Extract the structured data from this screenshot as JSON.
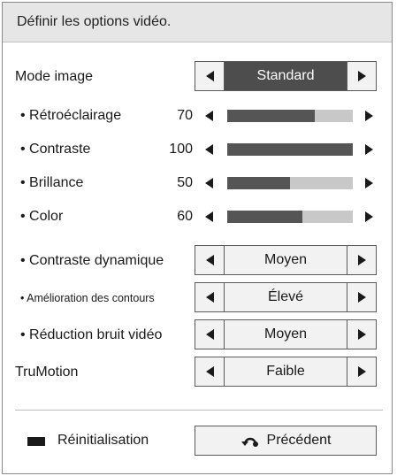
{
  "header": {
    "title": "Définir les options vidéo."
  },
  "mode_image": {
    "label": "Mode image",
    "value": "Standard"
  },
  "sliders": [
    {
      "label": "• Rétroéclairage",
      "value": 70
    },
    {
      "label": "• Contraste",
      "value": 100
    },
    {
      "label": "• Brillance",
      "value": 50
    },
    {
      "label": "• Color",
      "value": 60
    }
  ],
  "selectors": [
    {
      "label": "• Contraste dynamique",
      "value": "Moyen"
    },
    {
      "label": "• Amélioration des contours",
      "value": "Élevé"
    },
    {
      "label": "• Réduction bruit vidéo",
      "value": "Moyen"
    }
  ],
  "trumotion": {
    "label": "TruMotion",
    "value": "Faible"
  },
  "footer": {
    "reset_label": "Réinitialisation",
    "back_label": "Précédent",
    "back_icon": "return-icon",
    "reset_key_icon": "red-key-icon"
  },
  "colors": {
    "active_bg": "#4d4d4d",
    "slider_fill": "#555555",
    "slider_track": "#c8c8c8",
    "header_bg": "#e6e6e6"
  }
}
